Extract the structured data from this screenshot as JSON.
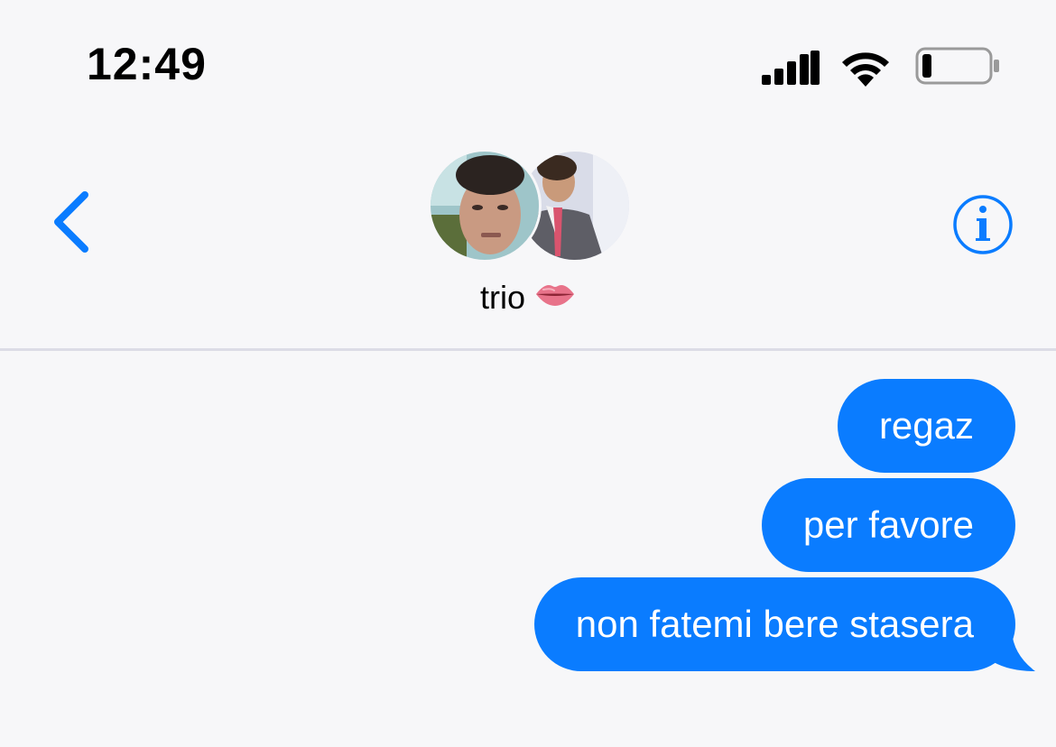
{
  "status_bar": {
    "time": "12:49",
    "icons": [
      "signal-icon",
      "wifi-icon",
      "battery-icon"
    ]
  },
  "header": {
    "back_icon": "chevron-left-icon",
    "info_icon": "info-icon",
    "group_name": "trio",
    "group_emoji": "lips-icon",
    "participants": [
      "avatar-1",
      "avatar-2"
    ]
  },
  "messages": [
    {
      "text": "regaz",
      "direction": "outgoing"
    },
    {
      "text": "per favore",
      "direction": "outgoing"
    },
    {
      "text": "non fatemi bere stasera",
      "direction": "outgoing"
    }
  ],
  "colors": {
    "accent": "#0a7cff",
    "background": "#f7f7f9",
    "divider": "#dcdce6"
  }
}
